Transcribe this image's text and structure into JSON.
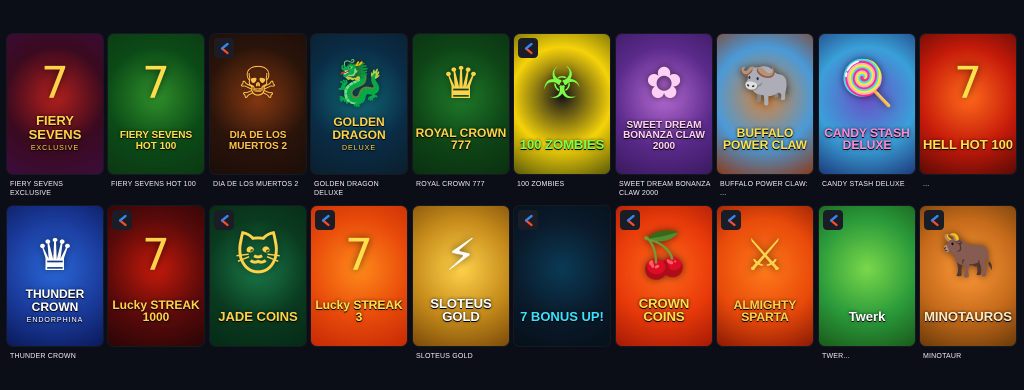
{
  "rows": [
    {
      "games": [
        {
          "title": "FIERY SEVENS EXCLUSIVE",
          "logo": "FIERY SEVENS",
          "logo_sub": "EXCLUSIVE",
          "art": "7",
          "badge": false,
          "colors": [
            "#3a0a1f",
            "#b4201d",
            "#3c0c3d"
          ],
          "logo_color": "#ffd24a"
        },
        {
          "title": "FIERY SEVENS HOT 100",
          "logo": "FIERY SEVENS HOT 100",
          "logo_sub": "",
          "art": "7",
          "badge": false,
          "colors": [
            "#0b4a17",
            "#2f8f2a",
            "#0c3812"
          ],
          "logo_color": "#ffdd4c"
        },
        {
          "title": "DIA DE LOS MUERTOS 2",
          "logo": "DIA DE LOS MUERTOS 2",
          "logo_sub": "",
          "art": "☠",
          "badge": true,
          "colors": [
            "#2a140a",
            "#8a3a12",
            "#1a0d08"
          ],
          "logo_color": "#ffc04a"
        },
        {
          "title": "GOLDEN DRAGON DELUXE",
          "logo": "GOLDEN DRAGON",
          "logo_sub": "DELUXE",
          "art": "🐉",
          "badge": false,
          "colors": [
            "#0a2c45",
            "#116b7a",
            "#0b1f2d"
          ],
          "logo_color": "#ffd24a"
        },
        {
          "title": "ROYAL CROWN 777",
          "logo": "ROYAL CROWN 777",
          "logo_sub": "",
          "art": "♛",
          "badge": false,
          "colors": [
            "#0e4416",
            "#1f7a2a",
            "#0a3010"
          ],
          "logo_color": "#ffd24a"
        },
        {
          "title": "100 ZOMBIES",
          "logo": "100 ZOMBIES",
          "logo_sub": "",
          "art": "☣",
          "badge": true,
          "colors": [
            "#f5d20a",
            "#1a1a1a",
            "#5a5a0a"
          ],
          "logo_color": "#7dff4a"
        },
        {
          "title": "SWEET DREAM BONANZA CLAW 2000",
          "logo": "SWEET DREAM BONANZA CLAW 2000",
          "logo_sub": "",
          "art": "✿",
          "badge": false,
          "colors": [
            "#5a2a8a",
            "#b56ad1",
            "#3a1a60"
          ],
          "logo_color": "#ffd0f5"
        },
        {
          "title": "BUFFALO POWER CLAW: ...",
          "logo": "BUFFALO POWER CLAW",
          "logo_sub": "",
          "art": "🐃",
          "badge": false,
          "colors": [
            "#4a9ad8",
            "#d9843a",
            "#8a3a1a"
          ],
          "logo_color": "#ffe04a"
        },
        {
          "title": "CANDY STASH DELUXE",
          "logo": "CANDY STASH DELUXE",
          "logo_sub": "",
          "art": "🍭",
          "badge": false,
          "colors": [
            "#3aa0d8",
            "#6a50c8",
            "#1d3a7a"
          ],
          "logo_color": "#ff8ad8"
        },
        {
          "title": "...",
          "logo": "HELL HOT 100",
          "logo_sub": "",
          "art": "7",
          "badge": false,
          "colors": [
            "#c41a0a",
            "#ff6a1a",
            "#5a0a05"
          ],
          "logo_color": "#ffe04a"
        }
      ]
    },
    {
      "games": [
        {
          "title": "THUNDER CROWN",
          "logo": "THUNDER CROWN",
          "logo_sub": "ENDORPHINA",
          "art": "♛",
          "badge": false,
          "colors": [
            "#1a3a9a",
            "#2a68d8",
            "#0a1a5a"
          ],
          "logo_color": "#ffffff"
        },
        {
          "title": "",
          "logo": "Lucky STREAK 1000",
          "logo_sub": "",
          "art": "7",
          "badge": true,
          "colors": [
            "#5a0a0a",
            "#c41a0a",
            "#2a0505"
          ],
          "logo_color": "#ffd24a"
        },
        {
          "title": "",
          "logo": "JADE COINS",
          "logo_sub": "",
          "art": "🐱",
          "badge": true,
          "colors": [
            "#0a3a1f",
            "#1a7a4a",
            "#052a15"
          ],
          "logo_color": "#ffd24a"
        },
        {
          "title": "",
          "logo": "Lucky STREAK 3",
          "logo_sub": "",
          "art": "7",
          "badge": true,
          "colors": [
            "#e84a0a",
            "#ff8a1a",
            "#c42a05"
          ],
          "logo_color": "#ffe04a"
        },
        {
          "title": "SLOTEUS GOLD",
          "logo": "SLOTEUS GOLD",
          "logo_sub": "",
          "art": "⚡",
          "badge": false,
          "colors": [
            "#c48a1a",
            "#ffd24a",
            "#7a4a0a"
          ],
          "logo_color": "#ffffff"
        },
        {
          "title": "",
          "logo": "7 BONUS UP!",
          "logo_sub": "",
          "art": "",
          "badge": true,
          "colors": [
            "#0a1a2a",
            "#0a3a55",
            "#05101a"
          ],
          "logo_color": "#3ae0ff"
        },
        {
          "title": "",
          "logo": "CROWN COINS",
          "logo_sub": "",
          "art": "🍒",
          "badge": true,
          "colors": [
            "#e83a0a",
            "#ff6a1a",
            "#a41a05"
          ],
          "logo_color": "#ffe04a"
        },
        {
          "title": "",
          "logo": "ALMIGHTY SPARTA",
          "logo_sub": "",
          "art": "⚔",
          "badge": true,
          "colors": [
            "#e84a0a",
            "#ff7a1a",
            "#8a1a05"
          ],
          "logo_color": "#ffd24a"
        },
        {
          "title": "TWER...",
          "logo": "Twerk",
          "logo_sub": "",
          "art": "",
          "badge": true,
          "colors": [
            "#2a9a3a",
            "#7ad84a",
            "#1a5a1a"
          ],
          "logo_color": "#ffffff"
        },
        {
          "title": "MINOTAUR",
          "logo": "MINOTAUROS",
          "logo_sub": "",
          "art": "🐂",
          "badge": true,
          "colors": [
            "#c46a1a",
            "#ff9a3a",
            "#6a3a0a"
          ],
          "logo_color": "#ffe9c4"
        }
      ]
    }
  ]
}
